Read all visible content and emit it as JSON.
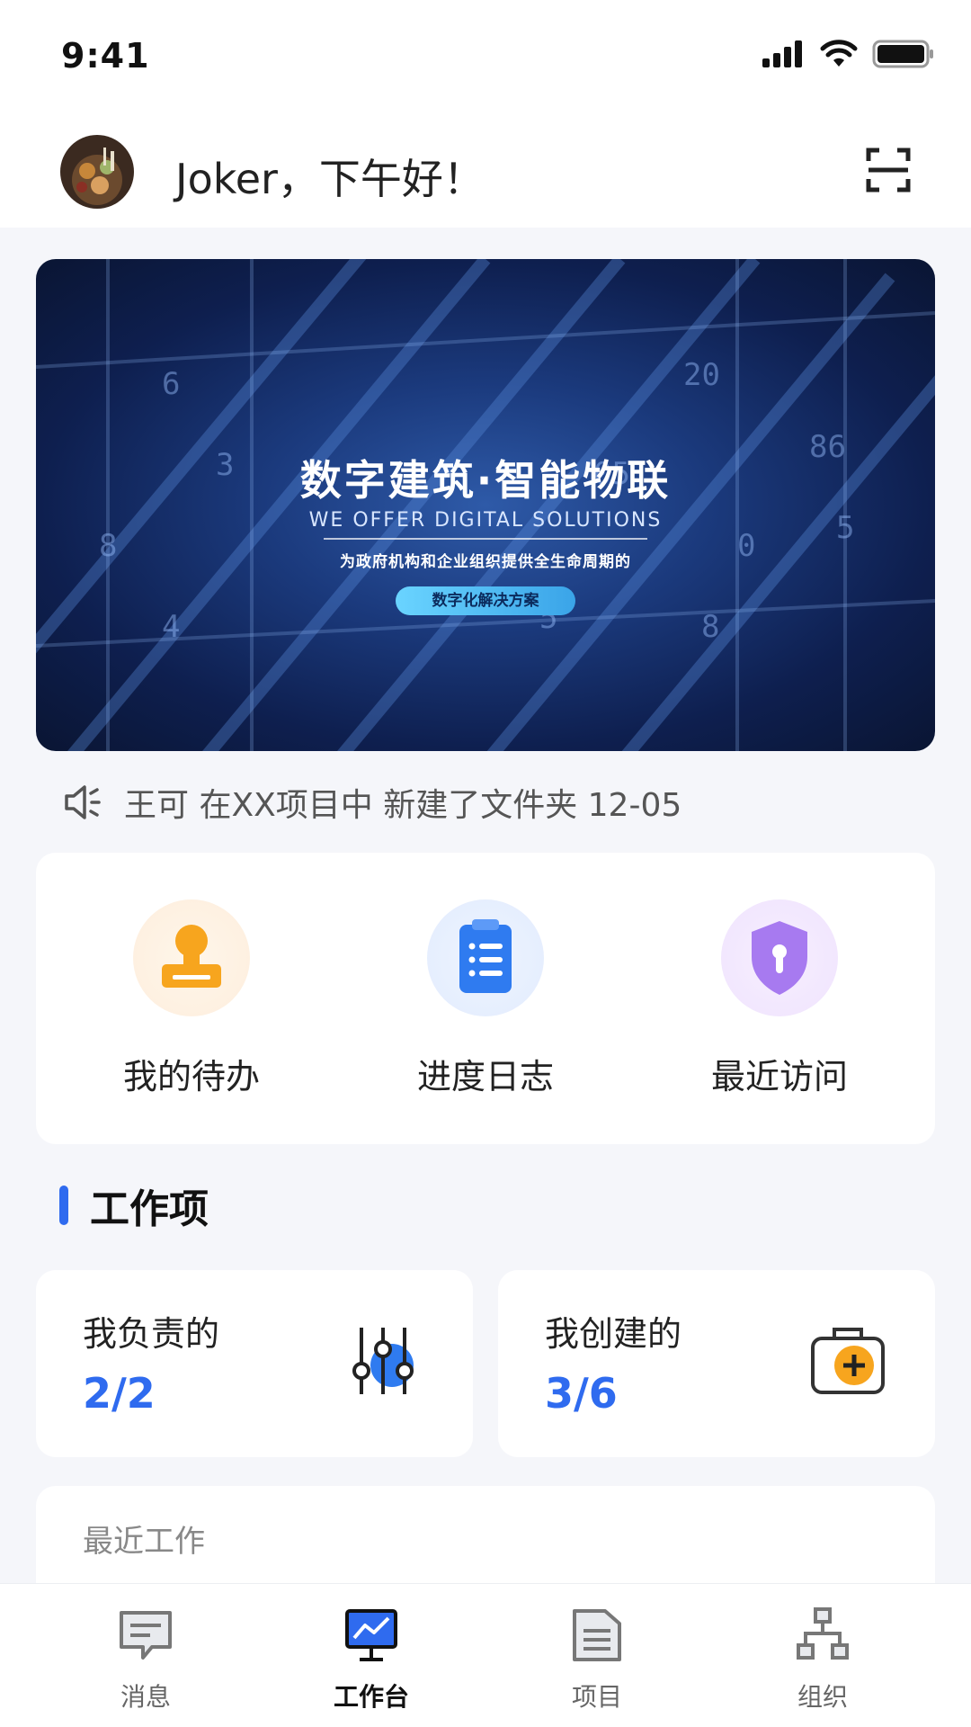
{
  "status_bar": {
    "time": "9:41"
  },
  "header": {
    "greeting": "Joker，下午好！"
  },
  "banner": {
    "title": "数字建筑·智能物联",
    "subtitle": "WE OFFER DIGITAL SOLUTIONS",
    "description": "为政府机构和企业组织提供全生命周期的",
    "pill": "数字化解决方案"
  },
  "notice": {
    "text": "王可 在XX项目中 新建了文件夹 12-05"
  },
  "quick_actions": [
    {
      "label": "我的待办",
      "icon": "stamp-icon",
      "color": "#f7a51e"
    },
    {
      "label": "进度日志",
      "icon": "clipboard-icon",
      "color": "#2f7bf0"
    },
    {
      "label": "最近访问",
      "icon": "shield-key-icon",
      "color": "#a77af0"
    }
  ],
  "section": {
    "title": "工作项"
  },
  "work_items": [
    {
      "title": "我负责的",
      "count": "2/2",
      "icon": "sliders-icon"
    },
    {
      "title": "我创建的",
      "count": "3/6",
      "icon": "add-case-icon"
    }
  ],
  "recent": {
    "title": "最近工作"
  },
  "nav": [
    {
      "label": "消息",
      "icon": "message-icon",
      "active": false
    },
    {
      "label": "工作台",
      "icon": "workbench-icon",
      "active": true
    },
    {
      "label": "项目",
      "icon": "project-icon",
      "active": false
    },
    {
      "label": "组织",
      "icon": "org-icon",
      "active": false
    }
  ],
  "colors": {
    "accent": "#2f6bef",
    "stamp": "#f7a51e",
    "clipboard": "#2f7bf0",
    "shield": "#a77af0"
  }
}
